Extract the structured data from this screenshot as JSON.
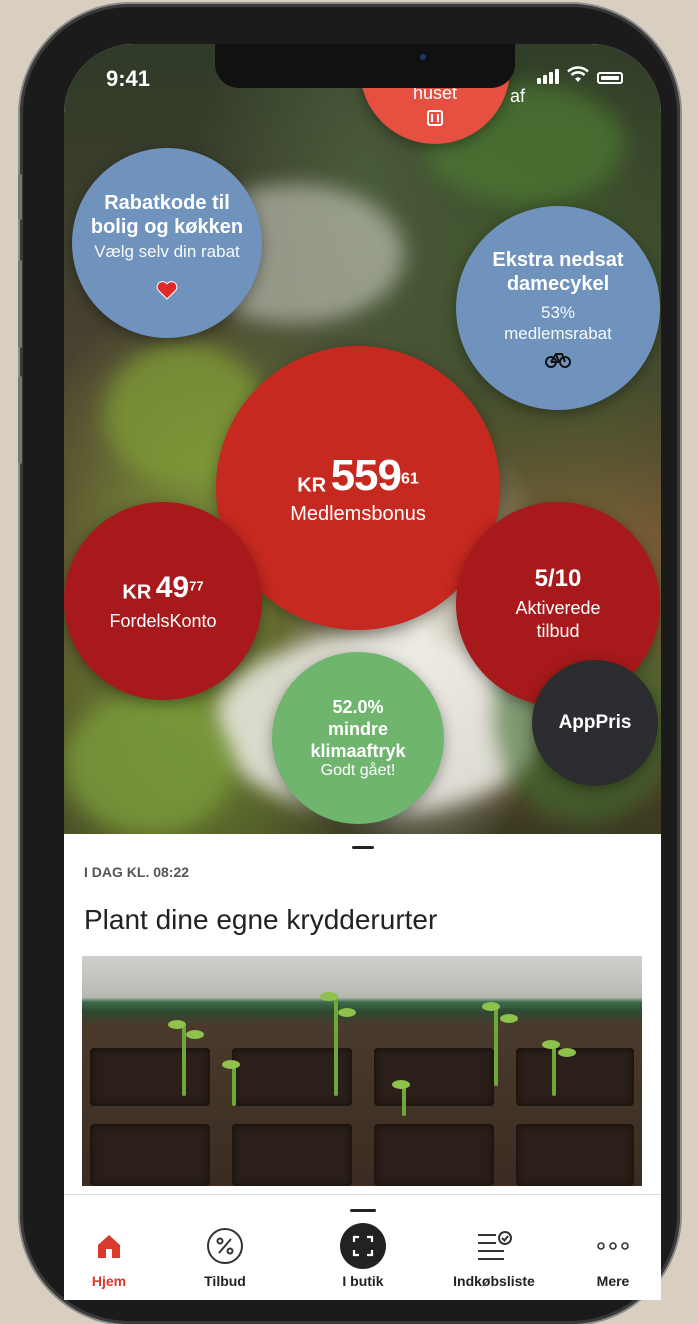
{
  "status_bar": {
    "time": "9:41"
  },
  "bubbles": {
    "top": {
      "line1": "huset",
      "partial": "af"
    },
    "rabatkode": {
      "title": "Rabatkode til bolig og køkken",
      "subtitle": "Vælg selv din rabat"
    },
    "cykel": {
      "title": "Ekstra nedsat damecykel",
      "subtitle": "53% medlemsrabat"
    },
    "bonus": {
      "currency": "KR",
      "amount": "559",
      "decimals": "61",
      "label": "Medlemsbonus"
    },
    "fordels": {
      "currency": "KR",
      "amount": "49",
      "decimals": "77",
      "label": "FordelsKonto"
    },
    "aktiverede": {
      "count": "5/10",
      "label": "Aktiverede tilbud"
    },
    "klima": {
      "value": "52.0%",
      "label": "mindre klimaaftryk",
      "sub": "Godt gået!"
    },
    "appris": {
      "label": "AppPris"
    }
  },
  "article": {
    "meta": "I DAG KL. 08:22",
    "headline": "Plant dine egne krydderurter"
  },
  "tabs": [
    {
      "label": "Hjem",
      "icon": "home-icon",
      "active": true
    },
    {
      "label": "Tilbud",
      "icon": "percent-icon"
    },
    {
      "label": "I butik",
      "icon": "scan-icon"
    },
    {
      "label": "Indkøbsliste",
      "icon": "list-check-icon"
    },
    {
      "label": "Mere",
      "icon": "more-icon"
    }
  ],
  "colors": {
    "accent": "#d93a2b",
    "blue_bubble": "#6f93bd",
    "red_bubble": "#c6291f",
    "green_bubble": "#6fb56e"
  }
}
